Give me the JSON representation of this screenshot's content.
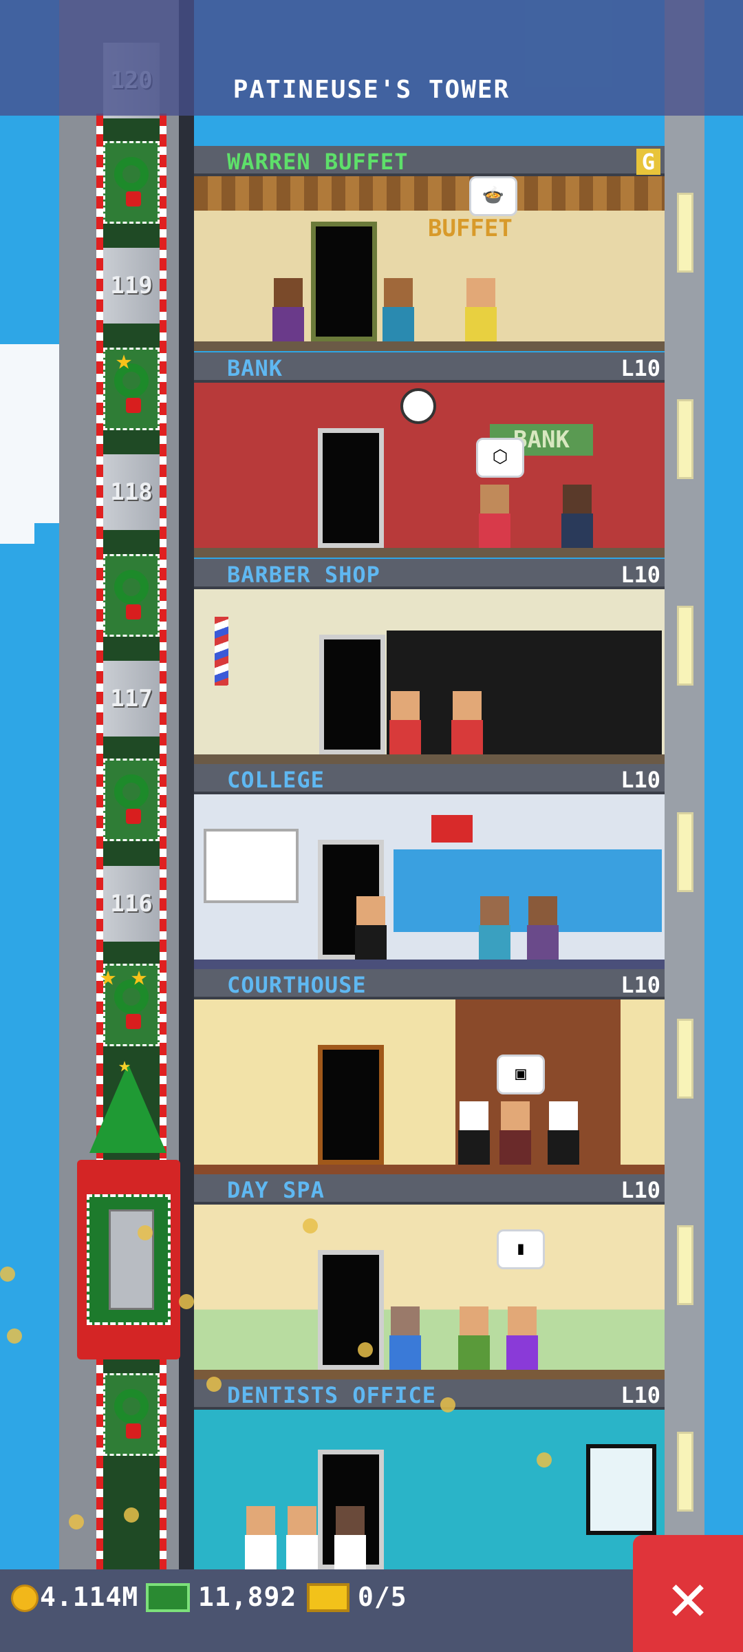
{
  "game": {
    "tower_title": "PATINEUSE'S TOWER"
  },
  "shaft": {
    "floor_numbers": [
      "120",
      "119",
      "118",
      "117",
      "116"
    ]
  },
  "floors": [
    {
      "name": "WARREN BUFFET",
      "level": "G",
      "sign": "BUFFET",
      "bubble": "🍲"
    },
    {
      "name": "BANK",
      "level": "L10",
      "sign": "BANK",
      "bubble": "⬡"
    },
    {
      "name": "BARBER SHOP",
      "level": "L10"
    },
    {
      "name": "COLLEGE",
      "level": "L10"
    },
    {
      "name": "COURTHOUSE",
      "level": "L10",
      "bubble": "▣"
    },
    {
      "name": "DAY SPA",
      "level": "L10",
      "bubble": "▮"
    },
    {
      "name": "DENTISTS OFFICE",
      "level": "L10"
    }
  ],
  "currency": {
    "coins": "4.114M",
    "bux": "11,892",
    "tickets": "0/5"
  },
  "colors": {
    "sky": "#2ea6e6",
    "shaft_green": "#1f4a25",
    "header_text": "#5fb8f2",
    "close_red": "#e0343a"
  },
  "icons": {
    "coin": "coin-icon",
    "bux": "bux-icon",
    "ticket": "ticket-icon",
    "close": "close-icon"
  }
}
